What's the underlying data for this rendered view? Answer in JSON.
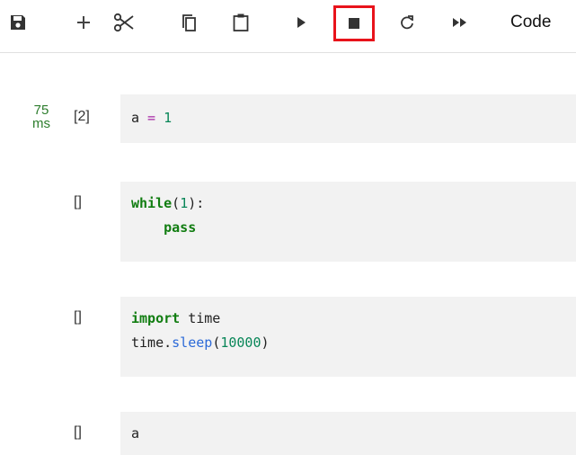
{
  "toolbar": {
    "items": [
      {
        "name": "save-icon"
      },
      {
        "name": "add-icon"
      },
      {
        "name": "cut-icon"
      },
      {
        "name": "copy-icon"
      },
      {
        "name": "paste-icon"
      },
      {
        "name": "run-icon"
      },
      {
        "name": "stop-icon"
      },
      {
        "name": "restart-icon"
      },
      {
        "name": "run-all-icon"
      }
    ],
    "cell_type": "Code"
  },
  "cells": [
    {
      "exec_time_value": "75",
      "exec_time_unit": "ms",
      "prompt": "[2]",
      "code": [
        [
          {
            "t": "a",
            "c": "plain"
          },
          {
            "t": " = ",
            "c": "op"
          },
          {
            "t": "1",
            "c": "num"
          }
        ]
      ]
    },
    {
      "prompt": "[]",
      "code": [
        [
          {
            "t": "while",
            "c": "kw"
          },
          {
            "t": "(",
            "c": "plain"
          },
          {
            "t": "1",
            "c": "num"
          },
          {
            "t": "):",
            "c": "plain"
          }
        ],
        [
          {
            "t": "    pass",
            "c": "kw"
          }
        ]
      ]
    },
    {
      "prompt": "[]",
      "code": [
        [
          {
            "t": "import",
            "c": "kw"
          },
          {
            "t": " time",
            "c": "plain"
          }
        ],
        [
          {
            "t": "time.",
            "c": "plain"
          },
          {
            "t": "sleep",
            "c": "fn"
          },
          {
            "t": "(",
            "c": "plain"
          },
          {
            "t": "10000",
            "c": "num"
          },
          {
            "t": ")",
            "c": "plain"
          }
        ]
      ]
    },
    {
      "prompt": "[]",
      "code": [
        [
          {
            "t": "a",
            "c": "plain"
          }
        ]
      ]
    }
  ],
  "colors": {
    "highlight_border": "#e8131b",
    "cell_background": "#f2f2f2",
    "keyword": "#117d11"
  }
}
